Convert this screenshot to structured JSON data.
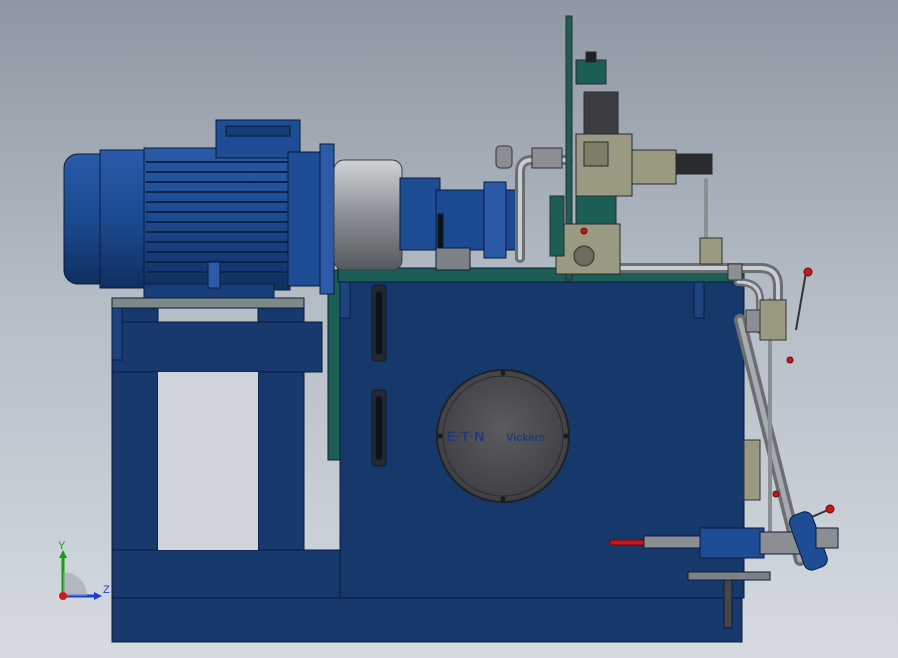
{
  "scene": {
    "logo": {
      "brand": "E·T·N",
      "product": "Vickers"
    },
    "triad": {
      "y_label": "Y",
      "z_label": "Z"
    }
  },
  "colors": {
    "frame_blue": "#17396e",
    "motor_blue": "#1e4d96",
    "tank_blue": "#17386b",
    "teal_panel": "#1c5d55",
    "steel_grey": "#8b8f93",
    "valve_body": "#9a9a82",
    "cover_grey": "#4e4f52",
    "handle_red": "#c41818"
  }
}
